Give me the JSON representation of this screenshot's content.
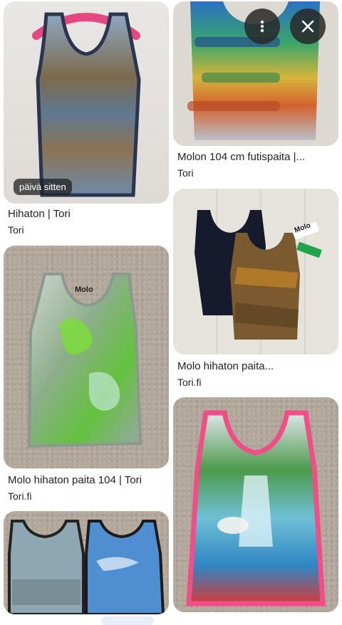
{
  "results": [
    {
      "id": "r1",
      "badge": "päivä sitten",
      "title": "Hihaton | Tori",
      "source": "Tori"
    },
    {
      "id": "r2",
      "title": "Molon 104 cm futispaita |...",
      "source": "Tori"
    },
    {
      "id": "r3",
      "tag": "Molo",
      "title": "Molo hihaton paita...",
      "source": "Tori.fi"
    },
    {
      "id": "r4",
      "tag": "Molo",
      "title": "Molo hihaton paita 104 | Tori",
      "source": "Tori.fi"
    },
    {
      "id": "r5"
    },
    {
      "id": "r6"
    }
  ],
  "icons": {
    "more": "more-vert-icon",
    "close": "close-icon"
  },
  "colors": {
    "hanger": "#e5487f",
    "tank_navy": "#1b2233",
    "tank_pink_trim": "#ef4f86"
  }
}
